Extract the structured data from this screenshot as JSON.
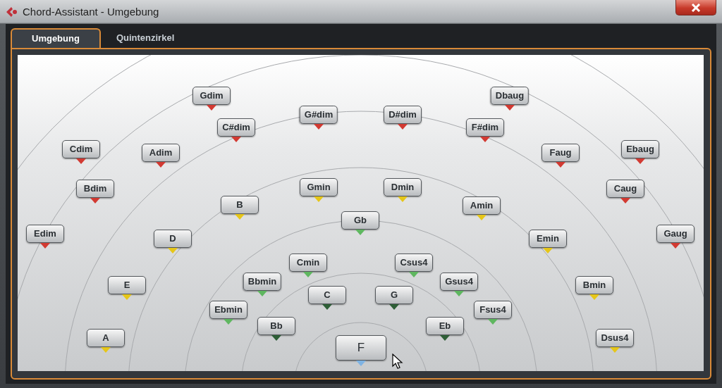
{
  "window": {
    "title": "Chord-Assistant - Umgebung"
  },
  "tabs": [
    {
      "label": "Umgebung",
      "selected": true
    },
    {
      "label": "Quintenzirkel",
      "selected": false
    }
  ],
  "chords": [
    {
      "label": "Gdim",
      "color": "#d23a32",
      "kind": "chord"
    },
    {
      "label": "Dbaug",
      "color": "#d23a32",
      "kind": "chord"
    },
    {
      "label": "G#dim",
      "color": "#d23a32",
      "kind": "chord"
    },
    {
      "label": "D#dim",
      "color": "#d23a32",
      "kind": "chord"
    },
    {
      "label": "C#dim",
      "color": "#d23a32",
      "kind": "chord"
    },
    {
      "label": "F#dim",
      "color": "#d23a32",
      "kind": "chord"
    },
    {
      "label": "Cdim",
      "color": "#d23a32",
      "kind": "chord"
    },
    {
      "label": "Adim",
      "color": "#d23a32",
      "kind": "chord"
    },
    {
      "label": "Faug",
      "color": "#d23a32",
      "kind": "chord"
    },
    {
      "label": "Ebaug",
      "color": "#d23a32",
      "kind": "chord"
    },
    {
      "label": "Bdim",
      "color": "#d23a32",
      "kind": "chord"
    },
    {
      "label": "Gmin",
      "color": "#e6c619",
      "kind": "chord"
    },
    {
      "label": "Dmin",
      "color": "#e6c619",
      "kind": "chord"
    },
    {
      "label": "Caug",
      "color": "#d23a32",
      "kind": "chord"
    },
    {
      "label": "B",
      "color": "#e6c619",
      "kind": "chord"
    },
    {
      "label": "Amin",
      "color": "#e6c619",
      "kind": "chord"
    },
    {
      "label": "Gb",
      "color": "#5fb760",
      "kind": "chord"
    },
    {
      "label": "Edim",
      "color": "#d23a32",
      "kind": "chord"
    },
    {
      "label": "D",
      "color": "#e6c619",
      "kind": "chord"
    },
    {
      "label": "Emin",
      "color": "#e6c619",
      "kind": "chord"
    },
    {
      "label": "Gaug",
      "color": "#d23a32",
      "kind": "chord"
    },
    {
      "label": "Cmin",
      "color": "#5fb760",
      "kind": "chord"
    },
    {
      "label": "Csus4",
      "color": "#5fb760",
      "kind": "chord"
    },
    {
      "label": "Bbmin",
      "color": "#5fb760",
      "kind": "chord"
    },
    {
      "label": "Gsus4",
      "color": "#5fb760",
      "kind": "chord"
    },
    {
      "label": "E",
      "color": "#e6c619",
      "kind": "chord"
    },
    {
      "label": "Bmin",
      "color": "#e6c619",
      "kind": "chord"
    },
    {
      "label": "C",
      "color": "#2e5f37",
      "kind": "chord"
    },
    {
      "label": "G",
      "color": "#2e5f37",
      "kind": "chord"
    },
    {
      "label": "Ebmin",
      "color": "#5fb760",
      "kind": "chord"
    },
    {
      "label": "Fsus4",
      "color": "#5fb760",
      "kind": "chord"
    },
    {
      "label": "Bb",
      "color": "#2e5f37",
      "kind": "chord"
    },
    {
      "label": "Eb",
      "color": "#2e5f37",
      "kind": "chord"
    },
    {
      "label": "A",
      "color": "#e6c619",
      "kind": "chord"
    },
    {
      "label": "Dsus4",
      "color": "#e6c619",
      "kind": "chord"
    },
    {
      "label": "F",
      "color": "#7fb3e3",
      "kind": "root"
    }
  ]
}
